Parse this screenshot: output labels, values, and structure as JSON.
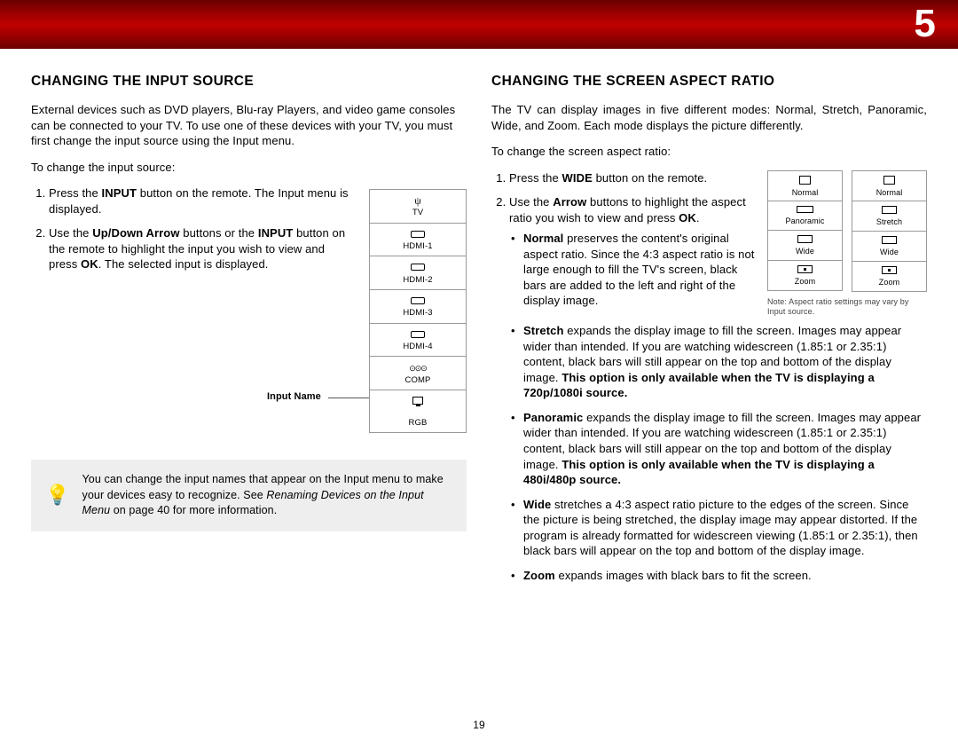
{
  "page_number_header": "5",
  "page_number_footer": "19",
  "left": {
    "heading": "CHANGING THE INPUT SOURCE",
    "intro": "External devices such as DVD players, Blu-ray Players, and video game consoles can be connected to your TV. To use one of these devices with your TV, you must first change the input source using the Input menu.",
    "lead": "To change the input source:",
    "step1a": "Press the ",
    "step1b": "INPUT",
    "step1c": " button on the remote. The Input menu is displayed.",
    "step2a": "Use the ",
    "step2b": "Up/Down Arrow",
    "step2c": " buttons or the ",
    "step2d": "INPUT",
    "step2e": " button on the remote to highlight the input you wish to view and press ",
    "step2f": "OK",
    "step2g": ". The selected input is displayed.",
    "callout": "Input Name",
    "menu": [
      "TV",
      "HDMI-1",
      "HDMI-2",
      "HDMI-3",
      "HDMI-4",
      "COMP",
      "RGB"
    ],
    "tip_a": "You can change the input names that appear on the Input menu to make your devices easy to recognize. See ",
    "tip_b": "Renaming Devices on the Input Menu",
    "tip_c": " on page 40 for more information."
  },
  "right": {
    "heading": "CHANGING THE SCREEN ASPECT RATIO",
    "intro": "The TV can display images in five different modes: Normal, Stretch, Panoramic, Wide, and Zoom. Each mode displays the picture differently.",
    "lead": "To change the screen aspect ratio:",
    "step1a": "Press the ",
    "step1b": "WIDE",
    "step1c": " button on the remote.",
    "step2a": "Use the ",
    "step2b": "Arrow",
    "step2c": " buttons to highlight the aspect ratio you wish to view and press ",
    "step2d": "OK",
    "step2e": ".",
    "menu1": [
      "Normal",
      "Panoramic",
      "Wide",
      "Zoom"
    ],
    "menu2": [
      "Normal",
      "Stretch",
      "Wide",
      "Zoom"
    ],
    "note": "Note: Aspect ratio settings may vary by Input source.",
    "b_normal_a": "Normal",
    "b_normal_b": " preserves the content's original aspect ratio. Since the 4:3 aspect ratio is not large enough to fill the TV's screen, black bars are added to the left and right of the display image.",
    "b_stretch_a": "Stretch",
    "b_stretch_b": " expands the display image to fill the screen. Images may appear wider than intended. If you are watching widescreen (1.85:1 or 2.35:1) content, black bars will still appear on the top and bottom of the display image. ",
    "b_stretch_c": "This option is only available when the TV is displaying a 720p/1080i source.",
    "b_pan_a": "Panoramic",
    "b_pan_b": " expands the display image to fill the screen. Images may appear wider than intended. If you are watching widescreen (1.85:1 or 2.35:1) content, black bars will still appear on the top and bottom of the display image. ",
    "b_pan_c": "This option is only available when the TV is displaying a 480i/480p source.",
    "b_wide_a": "Wide",
    "b_wide_b": " stretches a 4:3 aspect ratio picture to the edges of the screen. Since the picture is being stretched, the display image may appear distorted. If the program is already formatted for widescreen viewing (1.85:1 or 2.35:1), then black bars will appear on the top and bottom of the display image.",
    "b_zoom_a": "Zoom",
    "b_zoom_b": " expands images with black bars to fit the screen."
  }
}
